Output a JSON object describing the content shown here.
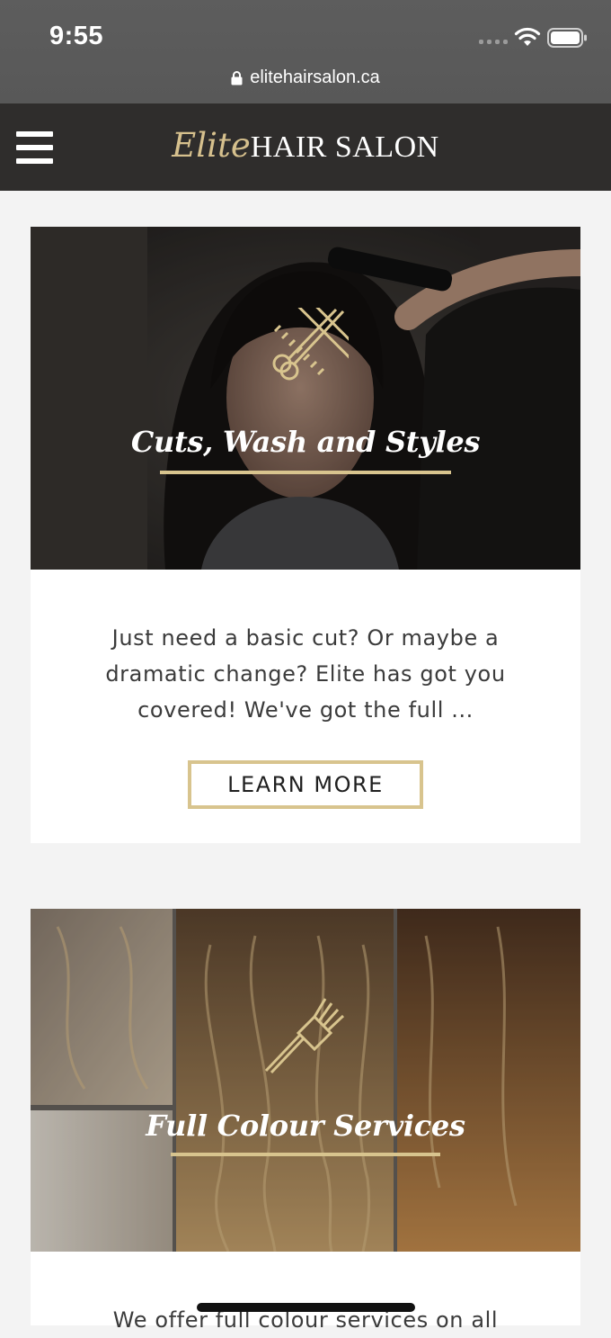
{
  "status_bar": {
    "time": "9:55",
    "url": "elitehairsalon.ca",
    "icons": [
      "signal-dots-icon",
      "wifi-icon",
      "battery-icon",
      "lock-icon"
    ]
  },
  "header": {
    "logo_script": "Elite",
    "logo_caps": "HAIR SALON",
    "menu_icon": "hamburger-menu-icon"
  },
  "colors": {
    "header_bg": "#2f2d2c",
    "gold": "#d8c48e",
    "page_bg": "#f3f3f3",
    "text": "#3b3b3b"
  },
  "cards": [
    {
      "icon": "comb-and-scissors-icon",
      "title": "Cuts, Wash and Styles",
      "description": "Just need a basic cut? Or maybe a dramatic change? Elite has got you covered! We've got the full ...",
      "button": "LEARN MORE"
    },
    {
      "icon": "tint-brush-icon",
      "title": "Full Colour Services",
      "description": "We offer full colour services on all"
    }
  ]
}
